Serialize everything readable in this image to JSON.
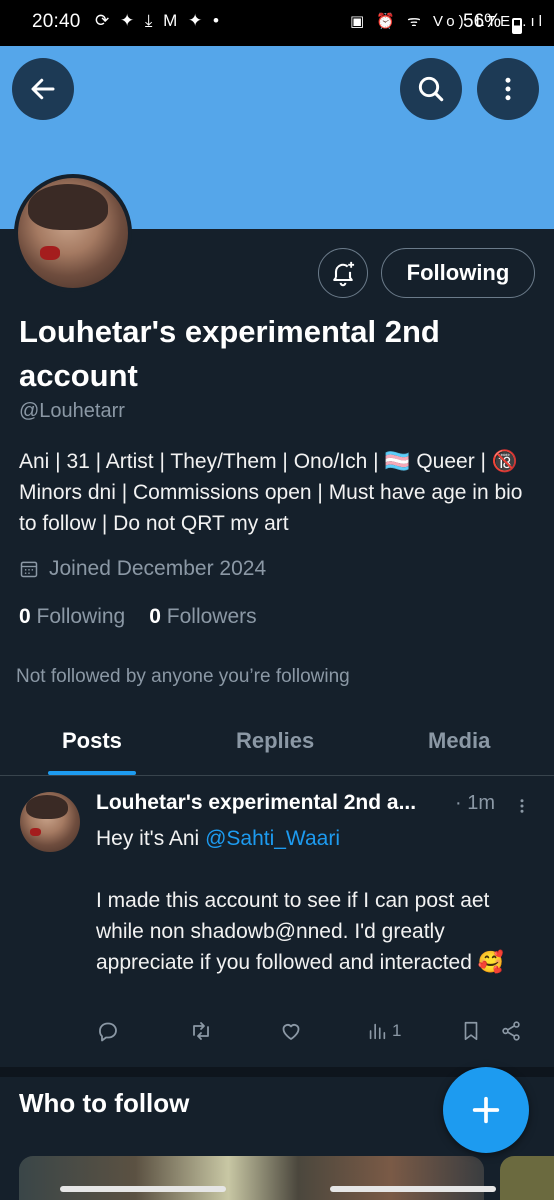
{
  "status_bar": {
    "time": "20:40",
    "left_icons": "⟳ ✦ ⤓ M ✦ •",
    "right_icons": "▣ ⏰ ᯤ Vo) LTE .ıl",
    "battery": "56%"
  },
  "profile": {
    "display_name": "Louhetar's experimental 2nd account",
    "handle": "@Louhetarr",
    "bio": "Ani | 31 | Artist | They/Them | Ono/Ich | 🏳️‍⚧️ Queer | 🔞 Minors dni | Commissions open | Must have age in bio to follow | Do not QRT my art",
    "joined": "Joined December 2024",
    "following_count": "0",
    "following_label": "Following",
    "followers_count": "0",
    "followers_label": "Followers",
    "not_followed_text": "Not followed by anyone you’re following",
    "follow_button_label": "Following"
  },
  "tabs": [
    {
      "label": "Posts",
      "active": true
    },
    {
      "label": "Replies",
      "active": false
    },
    {
      "label": "Media",
      "active": false
    }
  ],
  "post": {
    "author": "Louhetar's experimental 2nd a...",
    "time": "· 1m",
    "text_intro": "Hey it's Ani ",
    "mention": "@Sahti_Waari",
    "text_body": "I made this account to see if I can post aet while non shadowb@nned. I'd greatly appreciate if you followed and interacted 🥰",
    "views": "1"
  },
  "who_to_follow": {
    "title": "Who to follow"
  },
  "colors": {
    "background": "#15202b",
    "banner": "#55a6ea",
    "accent": "#1d9bf0",
    "muted": "#8b98a5"
  }
}
